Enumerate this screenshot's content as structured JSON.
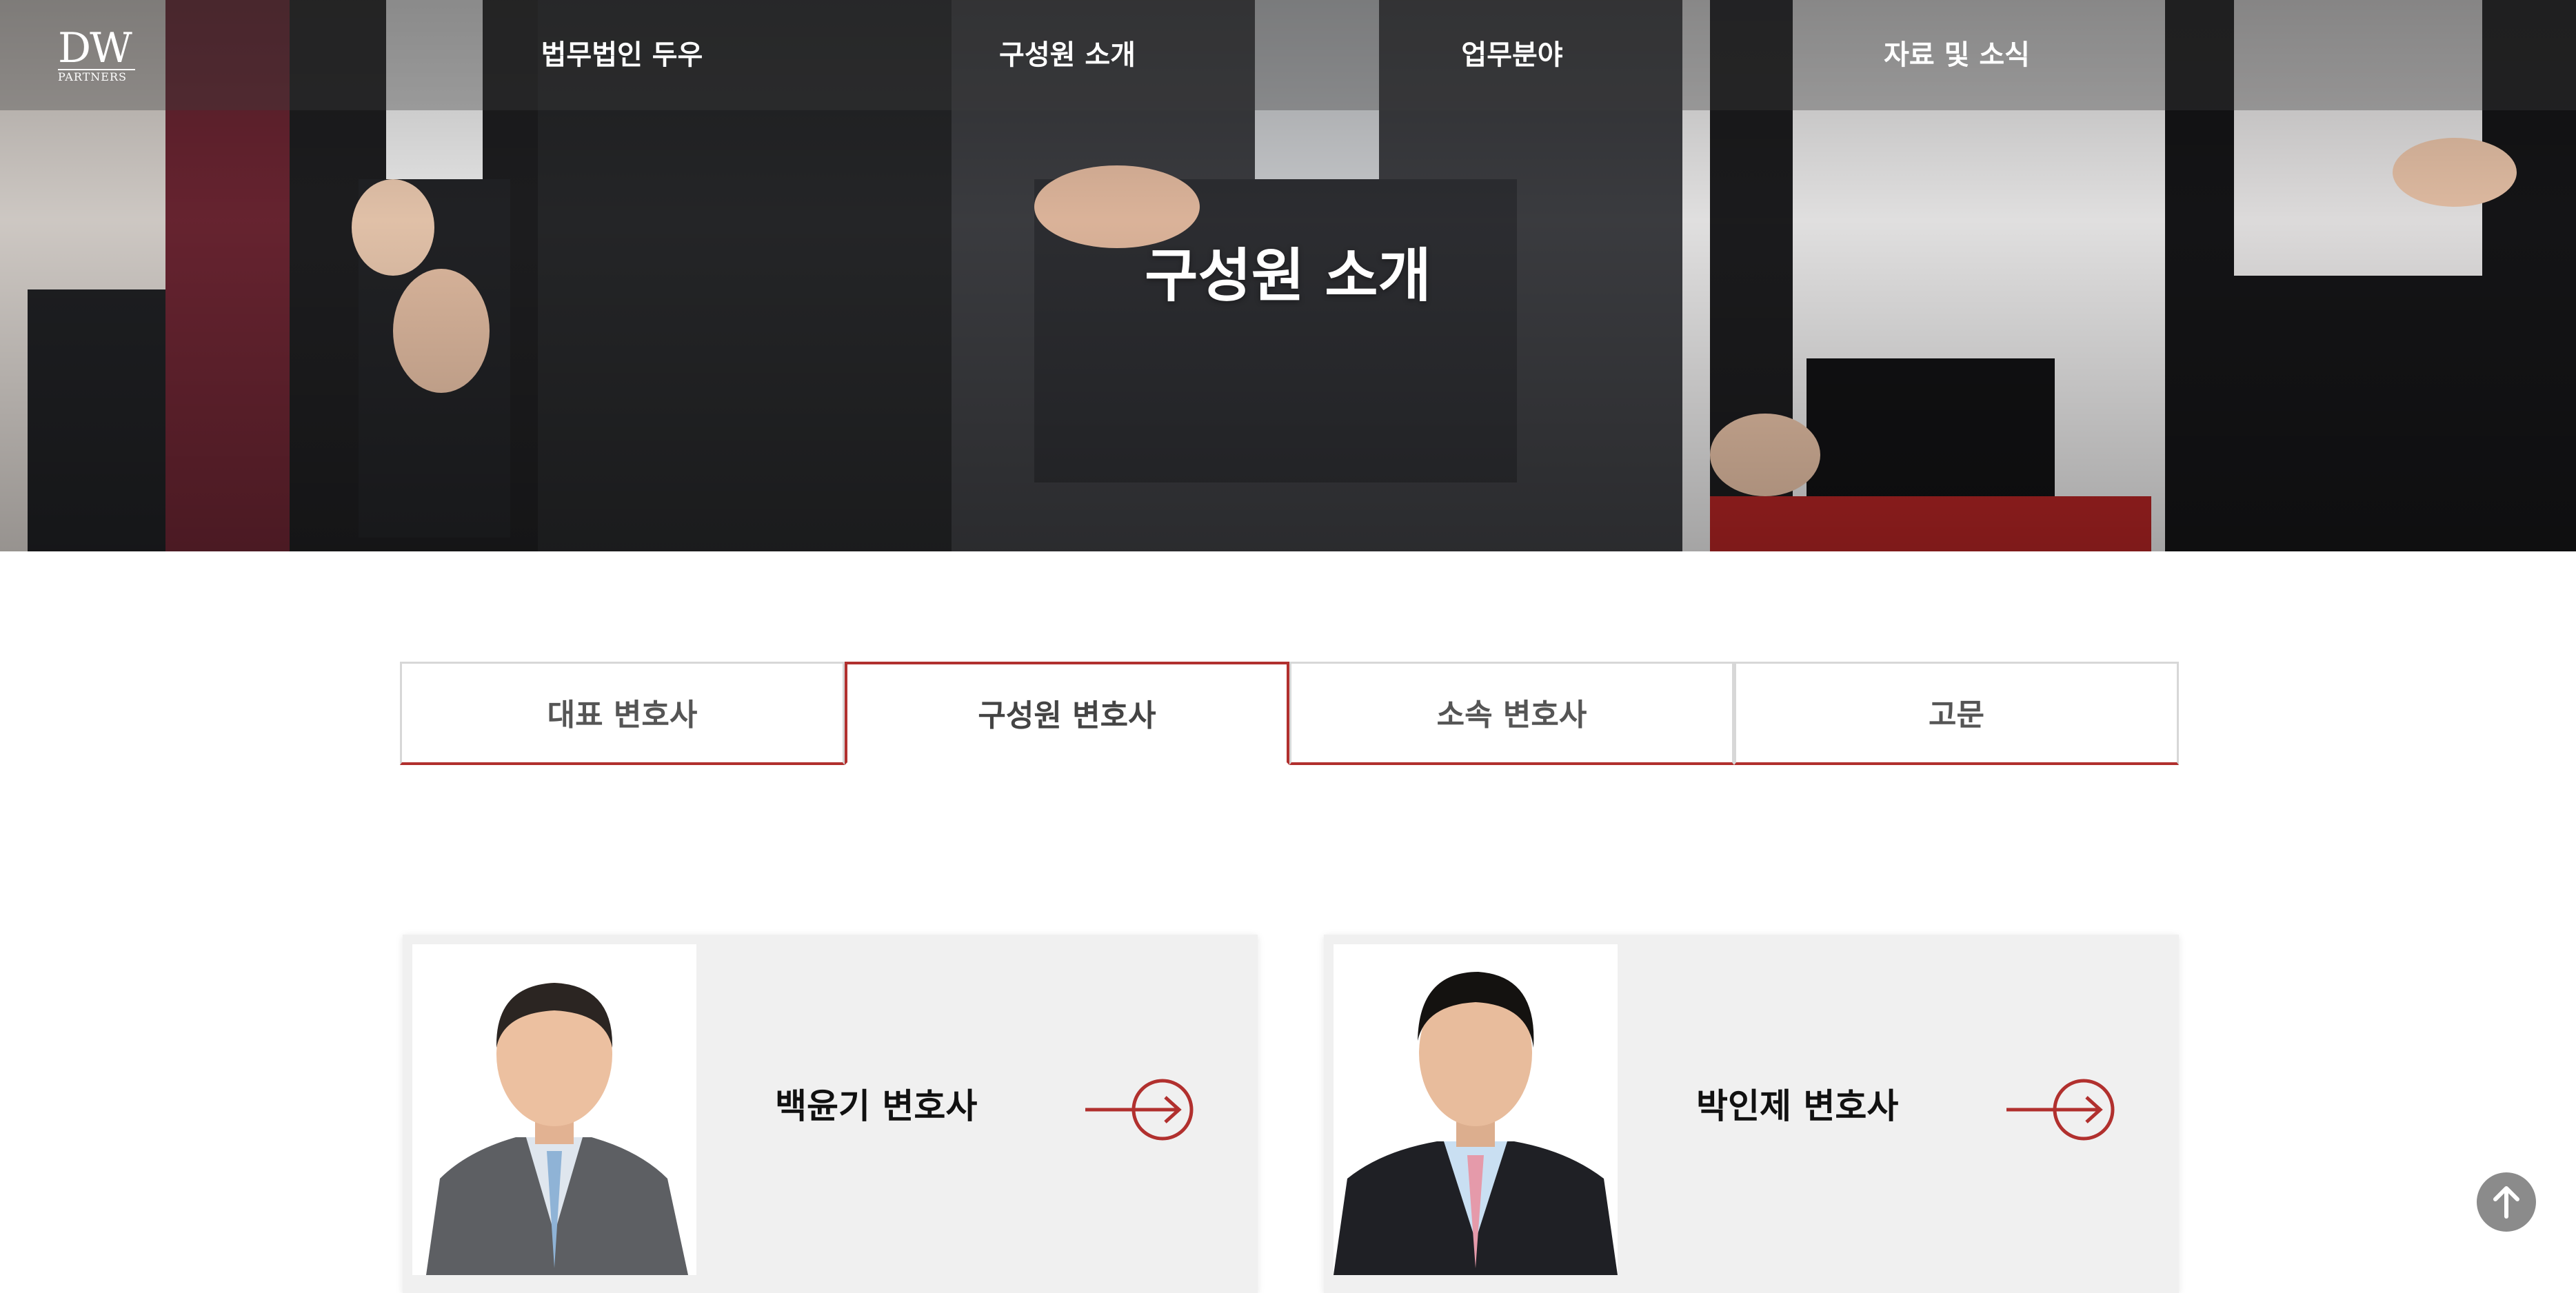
{
  "logo": {
    "mark": "DW",
    "sub": "PARTNERS"
  },
  "nav": {
    "items": [
      {
        "label": "법무법인 두우"
      },
      {
        "label": "구성원 소개"
      },
      {
        "label": "업무분야"
      },
      {
        "label": "자료 및 소식"
      }
    ]
  },
  "hero": {
    "title": "구성원 소개"
  },
  "tabs": [
    {
      "label": "대표 변호사",
      "active": false
    },
    {
      "label": "구성원 변호사",
      "active": true
    },
    {
      "label": "소속 변호사",
      "active": false
    },
    {
      "label": "고문",
      "active": false
    }
  ],
  "members": [
    {
      "name": "백윤기 변호사"
    },
    {
      "name": "박인제 변호사"
    }
  ],
  "colors": {
    "accent": "#b1302e",
    "card_bg": "#f0f0f0",
    "scroll_top_bg": "#8b8b8b"
  },
  "icons": {
    "arrow": "arrow-right-circle-icon",
    "scroll_top": "arrow-up-icon"
  }
}
